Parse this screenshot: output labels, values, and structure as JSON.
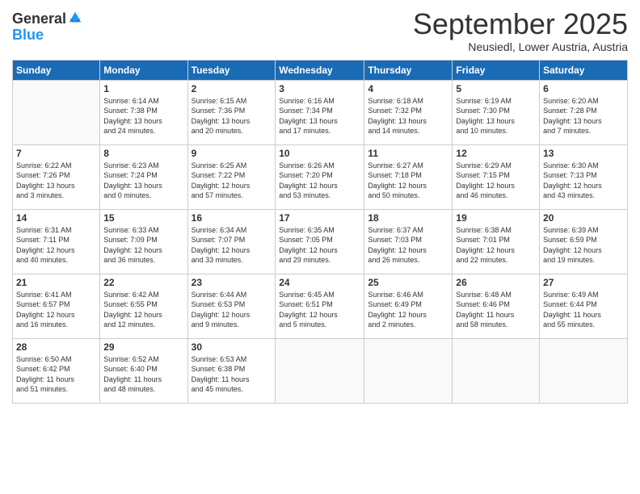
{
  "header": {
    "logo_general": "General",
    "logo_blue": "Blue",
    "month_title": "September 2025",
    "location": "Neusiedl, Lower Austria, Austria"
  },
  "days_of_week": [
    "Sunday",
    "Monday",
    "Tuesday",
    "Wednesday",
    "Thursday",
    "Friday",
    "Saturday"
  ],
  "weeks": [
    [
      {
        "day": "",
        "info": ""
      },
      {
        "day": "1",
        "info": "Sunrise: 6:14 AM\nSunset: 7:38 PM\nDaylight: 13 hours\nand 24 minutes."
      },
      {
        "day": "2",
        "info": "Sunrise: 6:15 AM\nSunset: 7:36 PM\nDaylight: 13 hours\nand 20 minutes."
      },
      {
        "day": "3",
        "info": "Sunrise: 6:16 AM\nSunset: 7:34 PM\nDaylight: 13 hours\nand 17 minutes."
      },
      {
        "day": "4",
        "info": "Sunrise: 6:18 AM\nSunset: 7:32 PM\nDaylight: 13 hours\nand 14 minutes."
      },
      {
        "day": "5",
        "info": "Sunrise: 6:19 AM\nSunset: 7:30 PM\nDaylight: 13 hours\nand 10 minutes."
      },
      {
        "day": "6",
        "info": "Sunrise: 6:20 AM\nSunset: 7:28 PM\nDaylight: 13 hours\nand 7 minutes."
      }
    ],
    [
      {
        "day": "7",
        "info": "Sunrise: 6:22 AM\nSunset: 7:26 PM\nDaylight: 13 hours\nand 3 minutes."
      },
      {
        "day": "8",
        "info": "Sunrise: 6:23 AM\nSunset: 7:24 PM\nDaylight: 13 hours\nand 0 minutes."
      },
      {
        "day": "9",
        "info": "Sunrise: 6:25 AM\nSunset: 7:22 PM\nDaylight: 12 hours\nand 57 minutes."
      },
      {
        "day": "10",
        "info": "Sunrise: 6:26 AM\nSunset: 7:20 PM\nDaylight: 12 hours\nand 53 minutes."
      },
      {
        "day": "11",
        "info": "Sunrise: 6:27 AM\nSunset: 7:18 PM\nDaylight: 12 hours\nand 50 minutes."
      },
      {
        "day": "12",
        "info": "Sunrise: 6:29 AM\nSunset: 7:15 PM\nDaylight: 12 hours\nand 46 minutes."
      },
      {
        "day": "13",
        "info": "Sunrise: 6:30 AM\nSunset: 7:13 PM\nDaylight: 12 hours\nand 43 minutes."
      }
    ],
    [
      {
        "day": "14",
        "info": "Sunrise: 6:31 AM\nSunset: 7:11 PM\nDaylight: 12 hours\nand 40 minutes."
      },
      {
        "day": "15",
        "info": "Sunrise: 6:33 AM\nSunset: 7:09 PM\nDaylight: 12 hours\nand 36 minutes."
      },
      {
        "day": "16",
        "info": "Sunrise: 6:34 AM\nSunset: 7:07 PM\nDaylight: 12 hours\nand 33 minutes."
      },
      {
        "day": "17",
        "info": "Sunrise: 6:35 AM\nSunset: 7:05 PM\nDaylight: 12 hours\nand 29 minutes."
      },
      {
        "day": "18",
        "info": "Sunrise: 6:37 AM\nSunset: 7:03 PM\nDaylight: 12 hours\nand 26 minutes."
      },
      {
        "day": "19",
        "info": "Sunrise: 6:38 AM\nSunset: 7:01 PM\nDaylight: 12 hours\nand 22 minutes."
      },
      {
        "day": "20",
        "info": "Sunrise: 6:39 AM\nSunset: 6:59 PM\nDaylight: 12 hours\nand 19 minutes."
      }
    ],
    [
      {
        "day": "21",
        "info": "Sunrise: 6:41 AM\nSunset: 6:57 PM\nDaylight: 12 hours\nand 16 minutes."
      },
      {
        "day": "22",
        "info": "Sunrise: 6:42 AM\nSunset: 6:55 PM\nDaylight: 12 hours\nand 12 minutes."
      },
      {
        "day": "23",
        "info": "Sunrise: 6:44 AM\nSunset: 6:53 PM\nDaylight: 12 hours\nand 9 minutes."
      },
      {
        "day": "24",
        "info": "Sunrise: 6:45 AM\nSunset: 6:51 PM\nDaylight: 12 hours\nand 5 minutes."
      },
      {
        "day": "25",
        "info": "Sunrise: 6:46 AM\nSunset: 6:49 PM\nDaylight: 12 hours\nand 2 minutes."
      },
      {
        "day": "26",
        "info": "Sunrise: 6:48 AM\nSunset: 6:46 PM\nDaylight: 11 hours\nand 58 minutes."
      },
      {
        "day": "27",
        "info": "Sunrise: 6:49 AM\nSunset: 6:44 PM\nDaylight: 11 hours\nand 55 minutes."
      }
    ],
    [
      {
        "day": "28",
        "info": "Sunrise: 6:50 AM\nSunset: 6:42 PM\nDaylight: 11 hours\nand 51 minutes."
      },
      {
        "day": "29",
        "info": "Sunrise: 6:52 AM\nSunset: 6:40 PM\nDaylight: 11 hours\nand 48 minutes."
      },
      {
        "day": "30",
        "info": "Sunrise: 6:53 AM\nSunset: 6:38 PM\nDaylight: 11 hours\nand 45 minutes."
      },
      {
        "day": "",
        "info": ""
      },
      {
        "day": "",
        "info": ""
      },
      {
        "day": "",
        "info": ""
      },
      {
        "day": "",
        "info": ""
      }
    ]
  ]
}
